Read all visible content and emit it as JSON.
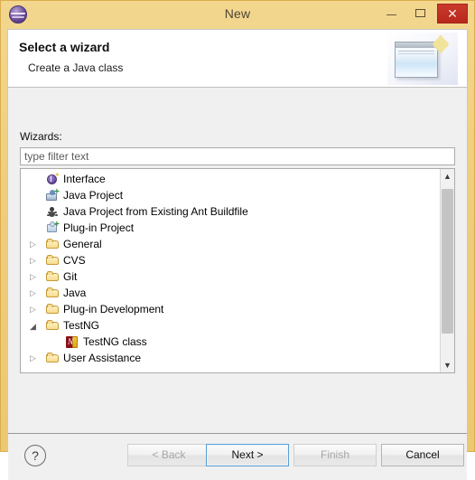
{
  "window": {
    "title": "New",
    "app_icon": "eclipse-icon",
    "controls": {
      "minimize": "minimize-icon",
      "maximize": "maximize-icon",
      "close": "✕"
    }
  },
  "header": {
    "title": "Select a wizard",
    "subtitle": "Create a Java class",
    "banner_icon": "wizard-banner-icon"
  },
  "content": {
    "wizards_label": "Wizards:",
    "filter": {
      "value": "",
      "placeholder": "type filter text"
    }
  },
  "tree": {
    "items": [
      {
        "label": "Interface",
        "icon": "interface-icon",
        "indent": 0,
        "twisty": "none",
        "leaf": true
      },
      {
        "label": "Java Project",
        "icon": "java-project-icon",
        "indent": 0,
        "twisty": "none",
        "leaf": true
      },
      {
        "label": "Java Project from Existing Ant Buildfile",
        "icon": "ant-buildfile-icon",
        "indent": 0,
        "twisty": "none",
        "leaf": true
      },
      {
        "label": "Plug-in Project",
        "icon": "plugin-project-icon",
        "indent": 0,
        "twisty": "none",
        "leaf": true
      },
      {
        "label": "General",
        "icon": "folder-icon",
        "indent": 0,
        "twisty": "collapsed",
        "leaf": false
      },
      {
        "label": "CVS",
        "icon": "folder-icon",
        "indent": 0,
        "twisty": "collapsed",
        "leaf": false
      },
      {
        "label": "Git",
        "icon": "folder-icon",
        "indent": 0,
        "twisty": "collapsed",
        "leaf": false
      },
      {
        "label": "Java",
        "icon": "folder-icon",
        "indent": 0,
        "twisty": "collapsed",
        "leaf": false
      },
      {
        "label": "Plug-in Development",
        "icon": "folder-icon",
        "indent": 0,
        "twisty": "collapsed",
        "leaf": false
      },
      {
        "label": "TestNG",
        "icon": "folder-icon",
        "indent": 0,
        "twisty": "expanded",
        "leaf": false
      },
      {
        "label": "TestNG class",
        "icon": "testng-class-icon",
        "indent": 1,
        "twisty": "none",
        "leaf": true
      },
      {
        "label": "User Assistance",
        "icon": "folder-icon",
        "indent": 0,
        "twisty": "collapsed",
        "leaf": false
      }
    ],
    "scrollbar": {
      "up": "▲",
      "down": "▼"
    }
  },
  "footer": {
    "help_label": "?",
    "buttons": [
      {
        "label": "< Back",
        "state": "disabled"
      },
      {
        "label": "Next >",
        "state": "focused"
      },
      {
        "label": "Finish",
        "state": "disabled"
      },
      {
        "label": "Cancel",
        "state": "normal"
      }
    ]
  },
  "colors": {
    "titlebar": "#efcd7d",
    "close_button": "#b8281c",
    "focus_border": "#5a9fd4",
    "tree_background": "#ffffff",
    "dialog_background": "#f0f0f0"
  }
}
